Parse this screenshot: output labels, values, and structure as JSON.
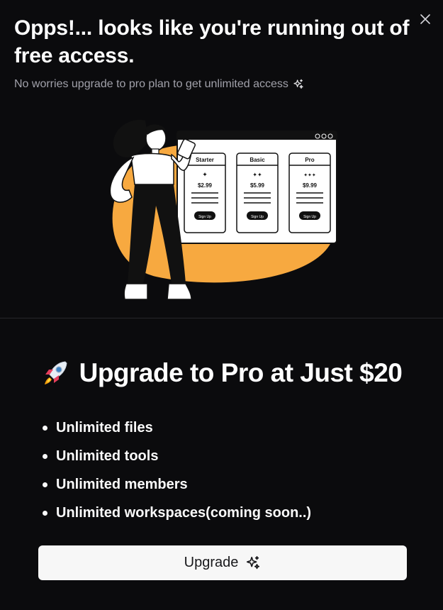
{
  "header": {
    "title": "Opps!... looks like you're running out of free access.",
    "subtitle": "No worries upgrade to pro plan to get unlimited access",
    "close_icon": "close-icon",
    "sparkle_icon": "sparkles-icon"
  },
  "illustration": {
    "plans": [
      {
        "name": "Starter",
        "price": "$2.99",
        "cta": "Sign Up"
      },
      {
        "name": "Basic",
        "price": "$5.99",
        "cta": "Sign Up"
      },
      {
        "name": "Pro",
        "price": "$9.99",
        "cta": "Sign Up"
      }
    ],
    "accent_color": "#f7a940"
  },
  "promo": {
    "title": "Upgrade to Pro at Just $20",
    "icon": "rocket-icon",
    "features": [
      "Unlimited files",
      "Unlimited tools",
      "Unlimited members",
      "Unlimited workspaces(coming soon..)"
    ]
  },
  "cta": {
    "label": "Upgrade",
    "icon": "sparkles-icon"
  },
  "colors": {
    "background": "#0b0b0d",
    "button_bg": "#f7f7f7",
    "subtitle": "#a1a1aa"
  }
}
